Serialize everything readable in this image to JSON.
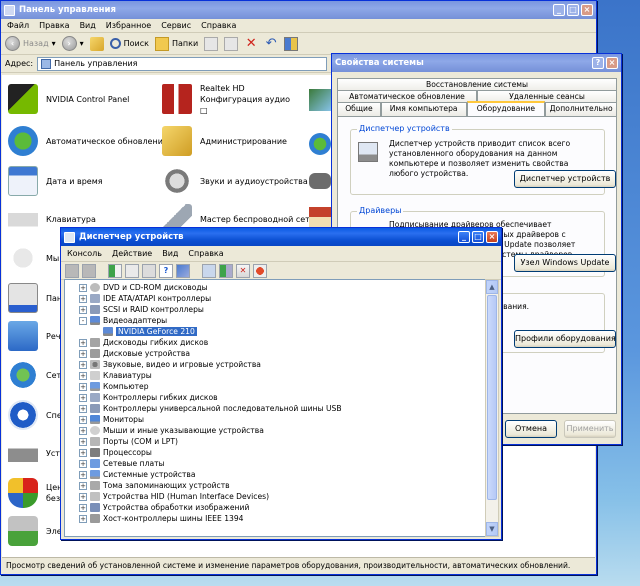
{
  "control_panel": {
    "title": "Панель управления",
    "menu": [
      "Файл",
      "Правка",
      "Вид",
      "Избранное",
      "Сервис",
      "Справка"
    ],
    "toolbar": {
      "back": "Назад",
      "search": "Поиск",
      "folders": "Папки"
    },
    "address_label": "Адрес:",
    "address_value": "Панель управления",
    "items": [
      {
        "label": "NVIDIA Control Panel",
        "icon": "nvidia-icon"
      },
      {
        "label": "Realtek HD Конфигурация аудио □",
        "icon": "realtek-speaker-icon"
      },
      {
        "label": "Автоматическое обновление",
        "icon": "globe-shield-icon"
      },
      {
        "label": "Администрирование",
        "icon": "admin-tools-folder-icon"
      },
      {
        "label": "Дата и время",
        "icon": "calendar-clock-icon"
      },
      {
        "label": "Звуки и аудиоустройства",
        "icon": "speaker-icon"
      },
      {
        "label": "Клавиатура",
        "icon": "keyboard-icon"
      },
      {
        "label": "Мастер беспроводной сети",
        "icon": "wireless-icon"
      },
      {
        "label": "Мы",
        "icon": "mouse-icon"
      },
      {
        "label": "Пан",
        "icon": "taskbar-icon"
      },
      {
        "label": "Речь",
        "icon": "speech-icon"
      },
      {
        "label": "Сет",
        "icon": "network-icon"
      },
      {
        "label": "Спе",
        "icon": "accessibility-icon"
      },
      {
        "label": "Уст",
        "icon": "printer-icon"
      },
      {
        "label": "Цен без",
        "icon": "security-shield-icon"
      },
      {
        "label": "Эле",
        "icon": "power-icon"
      }
    ],
    "status": "Просмотр сведений об установленной системе и изменение параметров оборудования, производительности, автоматических обновлений."
  },
  "system_properties": {
    "title": "Свойства системы",
    "tabs_row1": [
      "Восстановление системы"
    ],
    "tabs_row2": [
      "Автоматическое обновление",
      "Удаленные сеансы"
    ],
    "tabs_row3": [
      "Общие",
      "Имя компьютера",
      "Оборудование",
      "Дополнительно"
    ],
    "device_manager_group": {
      "title": "Диспетчер устройств",
      "text": "Диспетчер устройств приводит список всего установленного оборудования на данном компьютере и позволяет изменить свойства любого устройства.",
      "button": "Диспетчер устройств"
    },
    "drivers_group": {
      "title": "Драйверы",
      "text": "Подписывание драйверов обеспечивает совместимость установленных драйверов с системой Windows. Windows Update позволяет настроить способ поиска системы драйверов.",
      "button": "Узел Windows Update"
    },
    "profiles_group": {
      "text": "от устанавливать и оборудования.",
      "button": "Профили оборудования"
    },
    "buttons": {
      "cancel": "Отмена",
      "apply": "Применить"
    }
  },
  "device_manager": {
    "title": "Диспетчер устройств",
    "menu": [
      "Консоль",
      "Действие",
      "Вид",
      "Справка"
    ],
    "tree": [
      {
        "label": "DVD и CD-ROM дисководы",
        "level": 1,
        "expander": "+"
      },
      {
        "label": "IDE ATA/ATAPI контроллеры",
        "level": 1,
        "expander": "+"
      },
      {
        "label": "SCSI и RAID контроллеры",
        "level": 1,
        "expander": "+"
      },
      {
        "label": "Видеоадаптеры",
        "level": 1,
        "expander": "-"
      },
      {
        "label": "NVIDIA GeForce 210",
        "level": 2,
        "expander": "",
        "selected": true
      },
      {
        "label": "Дисководы гибких дисков",
        "level": 1,
        "expander": "+"
      },
      {
        "label": "Дисковые устройства",
        "level": 1,
        "expander": "+"
      },
      {
        "label": "Звуковые, видео и игровые устройства",
        "level": 1,
        "expander": "+"
      },
      {
        "label": "Клавиатуры",
        "level": 1,
        "expander": "+"
      },
      {
        "label": "Компьютер",
        "level": 1,
        "expander": "+"
      },
      {
        "label": "Контроллеры гибких дисков",
        "level": 1,
        "expander": "+"
      },
      {
        "label": "Контроллеры универсальной последовательной шины USB",
        "level": 1,
        "expander": "+"
      },
      {
        "label": "Мониторы",
        "level": 1,
        "expander": "+"
      },
      {
        "label": "Мыши и иные указывающие устройства",
        "level": 1,
        "expander": "+"
      },
      {
        "label": "Порты (COM и LPT)",
        "level": 1,
        "expander": "+"
      },
      {
        "label": "Процессоры",
        "level": 1,
        "expander": "+"
      },
      {
        "label": "Сетевые платы",
        "level": 1,
        "expander": "+"
      },
      {
        "label": "Системные устройства",
        "level": 1,
        "expander": "+"
      },
      {
        "label": "Тома запоминающих устройств",
        "level": 1,
        "expander": "+"
      },
      {
        "label": "Устройства HID (Human Interface Devices)",
        "level": 1,
        "expander": "+"
      },
      {
        "label": "Устройства обработки изображений",
        "level": 1,
        "expander": "+"
      },
      {
        "label": "Хост-контроллеры шины IEEE 1394",
        "level": 1,
        "expander": "+"
      }
    ]
  },
  "colors": {
    "title_active": "#0a5be3",
    "title_inactive": "#7a96df",
    "selection": "#316ac5",
    "window_face": "#ece9d8"
  }
}
